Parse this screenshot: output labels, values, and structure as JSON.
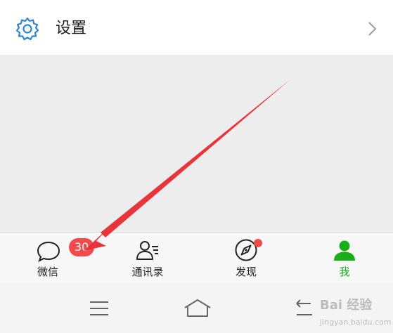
{
  "settings": {
    "label": "设置",
    "icon": "gear-icon",
    "chevron_icon": "chevron-right-icon"
  },
  "tabs": [
    {
      "label": "微信",
      "icon": "chat-bubble-icon",
      "badge": "30",
      "active": false
    },
    {
      "label": "通讯录",
      "icon": "contacts-icon",
      "active": false
    },
    {
      "label": "发现",
      "icon": "compass-icon",
      "has_dot": true,
      "active": false
    },
    {
      "label": "我",
      "icon": "person-icon",
      "active": true
    }
  ],
  "system_nav": [
    "menu-icon",
    "home-icon",
    "back-icon"
  ],
  "annotation": {
    "color": "#e8343a",
    "points_to": "微信"
  },
  "watermark": {
    "main": "Bai 经验",
    "sub": "jingyan.baidu.com"
  },
  "colors": {
    "accent_green": "#1aad19",
    "badge_red": "#f24b4b",
    "settings_icon_blue": "#2f82d4"
  }
}
